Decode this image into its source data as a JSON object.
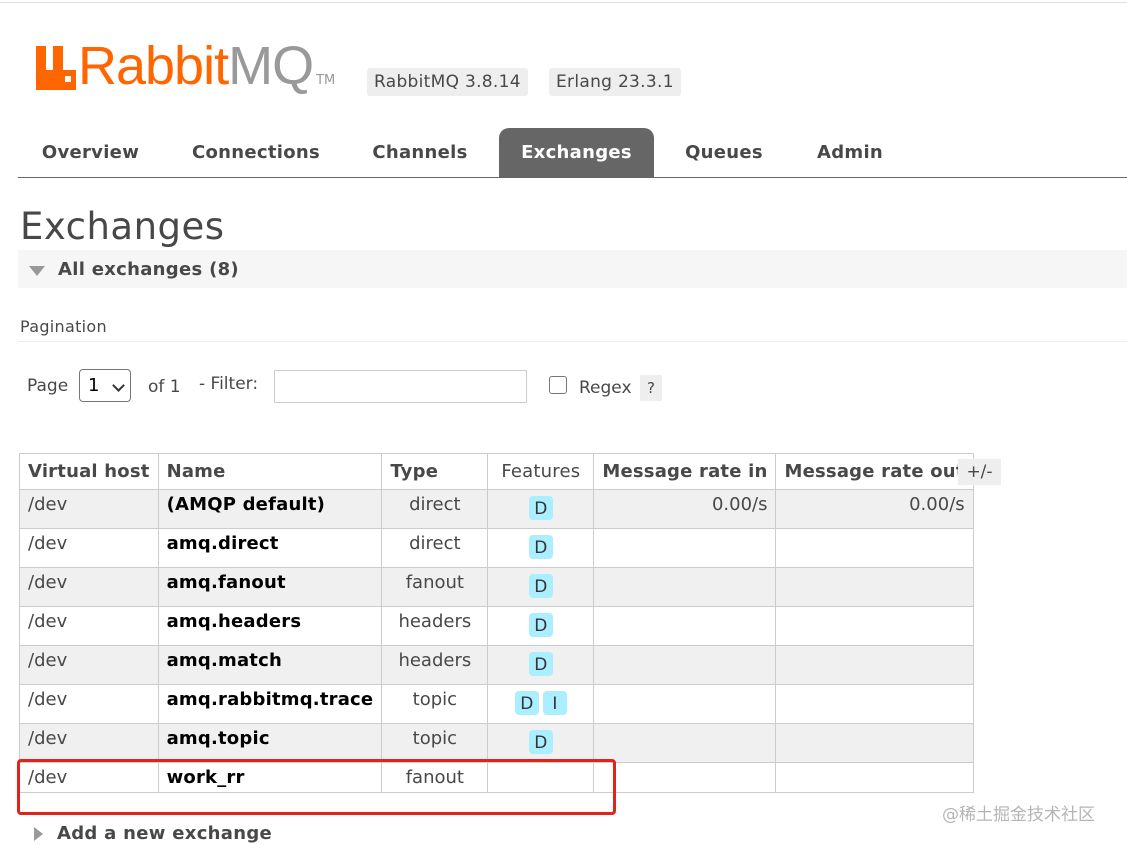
{
  "header": {
    "logo_text_1": "Rabbit",
    "logo_text_2": "MQ",
    "logo_tm": "TM",
    "version_rabbitmq": "RabbitMQ 3.8.14",
    "version_erlang": "Erlang 23.3.1"
  },
  "tabs": [
    {
      "label": "Overview"
    },
    {
      "label": "Connections"
    },
    {
      "label": "Channels"
    },
    {
      "label": "Exchanges",
      "active": true
    },
    {
      "label": "Queues"
    },
    {
      "label": "Admin"
    }
  ],
  "page_title": "Exchanges",
  "section_title": "All exchanges (8)",
  "pagination": {
    "label": "Pagination",
    "page_label": "Page",
    "page_value": "1",
    "of_label": "of 1",
    "filter_label": "- Filter:",
    "filter_value": "",
    "regex_label": "Regex",
    "help": "?"
  },
  "table": {
    "headers": [
      "Virtual host",
      "Name",
      "Type",
      "Features",
      "Message rate in",
      "Message rate out"
    ],
    "plus_minus": "+/-",
    "rows": [
      {
        "vhost": "/dev",
        "name": "(AMQP default)",
        "type": "direct",
        "features": [
          "D"
        ],
        "rate_in": "0.00/s",
        "rate_out": "0.00/s"
      },
      {
        "vhost": "/dev",
        "name": "amq.direct",
        "type": "direct",
        "features": [
          "D"
        ],
        "rate_in": "",
        "rate_out": ""
      },
      {
        "vhost": "/dev",
        "name": "amq.fanout",
        "type": "fanout",
        "features": [
          "D"
        ],
        "rate_in": "",
        "rate_out": ""
      },
      {
        "vhost": "/dev",
        "name": "amq.headers",
        "type": "headers",
        "features": [
          "D"
        ],
        "rate_in": "",
        "rate_out": ""
      },
      {
        "vhost": "/dev",
        "name": "amq.match",
        "type": "headers",
        "features": [
          "D"
        ],
        "rate_in": "",
        "rate_out": ""
      },
      {
        "vhost": "/dev",
        "name": "amq.rabbitmq.trace",
        "type": "topic",
        "features": [
          "D",
          "I"
        ],
        "rate_in": "",
        "rate_out": ""
      },
      {
        "vhost": "/dev",
        "name": "amq.topic",
        "type": "topic",
        "features": [
          "D"
        ],
        "rate_in": "",
        "rate_out": ""
      },
      {
        "vhost": "/dev",
        "name": "work_rr",
        "type": "fanout",
        "features": [],
        "rate_in": "",
        "rate_out": ""
      }
    ]
  },
  "add_exchange_label": "Add a new exchange",
  "watermark": "@稀土掘金技术社区",
  "colors": {
    "brand_orange": "#ff6600",
    "tab_active_bg": "#666666",
    "feature_badge": "#aaeeff",
    "highlight_red": "#e2231a"
  }
}
